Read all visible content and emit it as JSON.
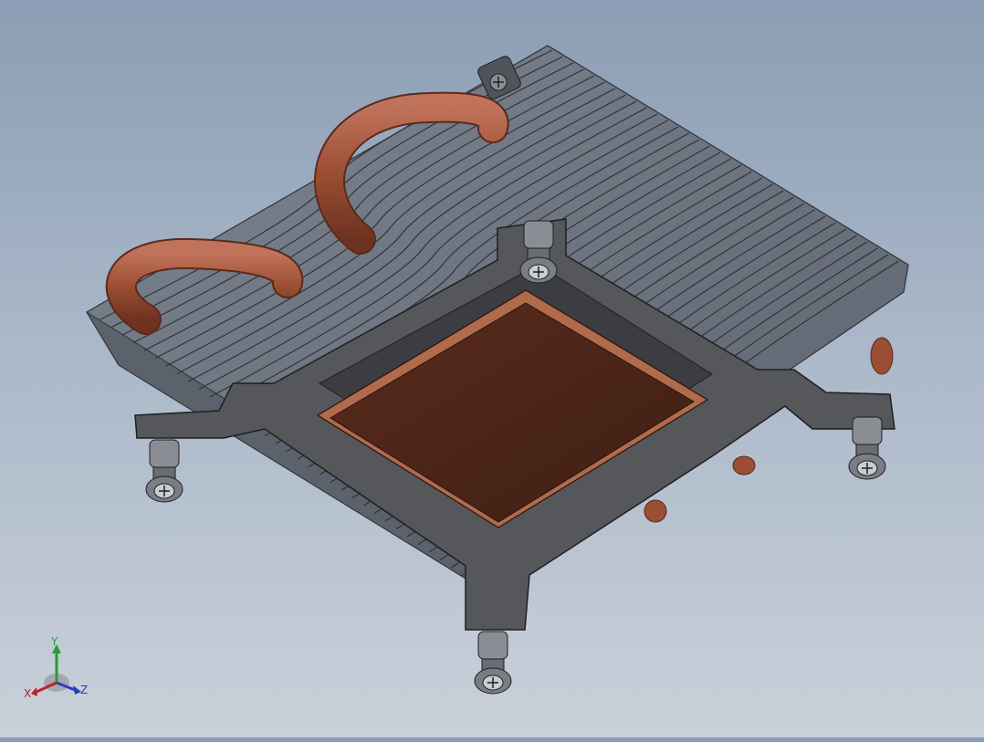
{
  "viewport": {
    "model": "cpu-heatsink-with-heatpipes",
    "background_top": "#8b9db4",
    "background_bottom": "#c9d0da"
  },
  "colors": {
    "fin": "#6f7782",
    "fin_dark": "#3a3f46",
    "bracket": "#54565a",
    "copper": "#4a2418",
    "copper_edge": "#b06a4c",
    "heatpipe": "#9b4e33"
  },
  "triad": {
    "x_label": "X",
    "y_label": "Y",
    "z_label": "Z",
    "x_color": "#c0202a",
    "y_color": "#2a9a35",
    "z_color": "#2a3dc0"
  }
}
